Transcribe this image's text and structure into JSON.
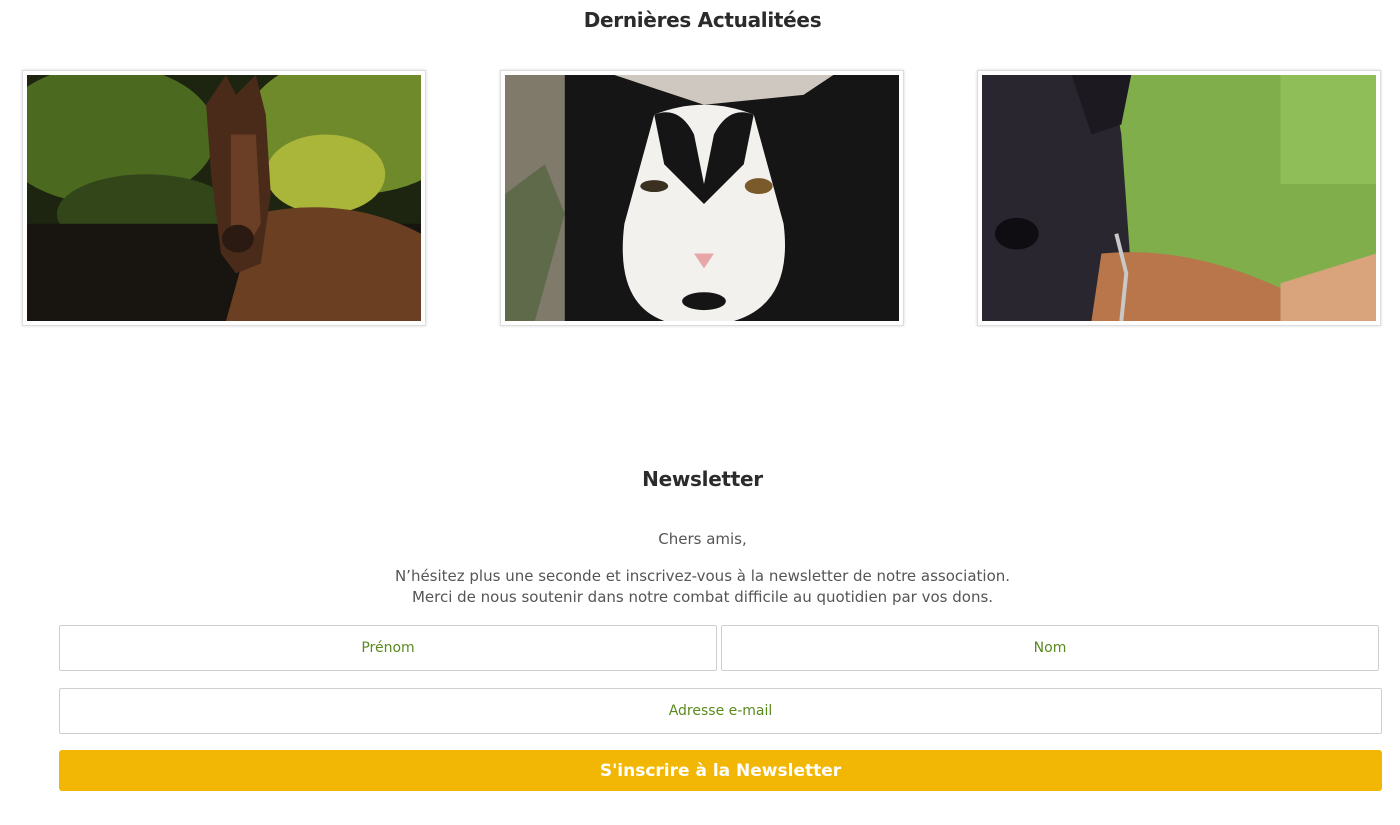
{
  "news": {
    "title": "Dernières Actualitées",
    "cards": [
      {
        "subject": "horse",
        "image_icon": "horse-photo"
      },
      {
        "subject": "cat",
        "image_icon": "cat-photo"
      },
      {
        "subject": "dog",
        "image_icon": "dog-photo"
      }
    ]
  },
  "newsletter": {
    "title": "Newsletter",
    "greeting": "Chers amis,",
    "line1": "N’hésitez plus une seconde et inscrivez-vous à la newsletter de notre association.",
    "line2": "Merci de nous soutenir dans notre combat difficile au quotidien par vos dons.",
    "firstname_placeholder": "Prénom",
    "lastname_placeholder": "Nom",
    "email_placeholder": "Adresse e-mail",
    "submit_label": "S'inscrire à la Newsletter"
  },
  "colors": {
    "accent": "#f2b705",
    "placeholder_text": "#5a8a1e",
    "heading": "#2b2b2b",
    "body_text": "#555555"
  }
}
